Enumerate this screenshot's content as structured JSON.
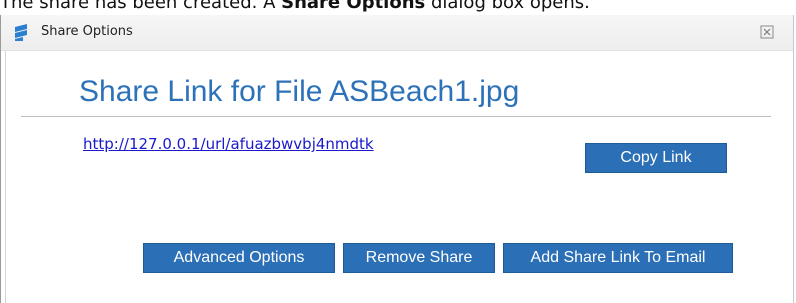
{
  "caption": {
    "prefix": "The share has been created. A ",
    "bold": "Share Options",
    "suffix": " dialog box opens."
  },
  "dialog": {
    "title": "Share Options",
    "heading": "Share Link for File ASBeach1.jpg",
    "link": "http://127.0.0.1/url/afuazbwvbj4nmdtk",
    "buttons": {
      "copy": "Copy Link",
      "advanced": "Advanced Options",
      "remove": "Remove Share",
      "email": "Add Share Link To Email"
    }
  },
  "colors": {
    "accent": "#2b6fb6",
    "heading": "#2d72b8",
    "link": "#1a1acc"
  },
  "icons": {
    "app": "share-app-icon",
    "close": "close-icon"
  }
}
